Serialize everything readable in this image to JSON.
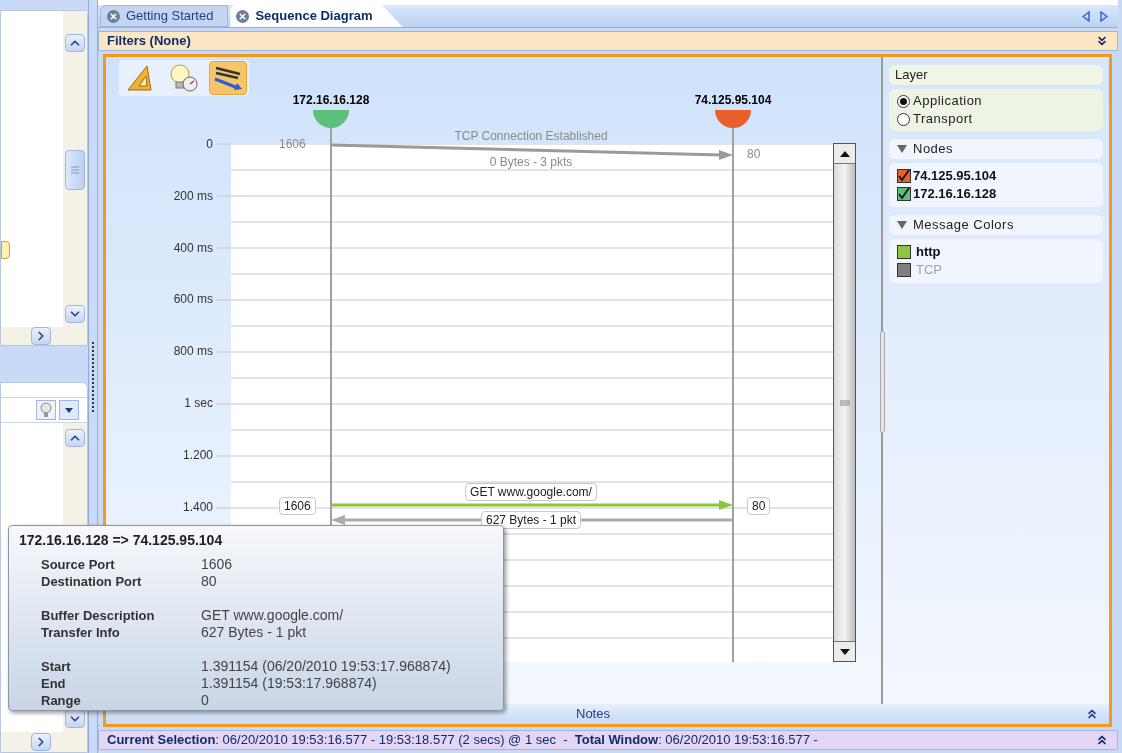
{
  "tabs": [
    {
      "label": "Getting Started",
      "selected": false
    },
    {
      "label": "Sequence Diagram",
      "selected": true
    }
  ],
  "filters": {
    "title": "Filters (None)"
  },
  "toolbar": [
    {
      "kind": "ruler",
      "selected": false
    },
    {
      "kind": "bulb",
      "selected": false
    },
    {
      "kind": "protocol",
      "selected": true
    }
  ],
  "diagram": {
    "nodes": [
      {
        "label": "172.16.16.128",
        "color": "#5cbf7c"
      },
      {
        "label": "74.125.95.104",
        "color": "#e8612c"
      }
    ],
    "axis_labels": [
      "0",
      "200 ms",
      "400 ms",
      "600 ms",
      "800 ms",
      "1 sec",
      "1.200",
      "1.400"
    ],
    "messages": [
      {
        "kind": "connection",
        "above": "TCP Connection Established",
        "below": "0 Bytes - 3 pkts",
        "source_port": "1606",
        "dest_port": "80",
        "color": "#9a9a9a"
      },
      {
        "kind": "request",
        "above": "GET www.google.com/",
        "source_port": "1606",
        "dest_port": "80",
        "color": "#8cc63f"
      },
      {
        "kind": "response",
        "below": "627 Bytes - 1 pkt",
        "color": "#ababab"
      }
    ]
  },
  "legend": {
    "layer": {
      "title": "Layer",
      "options": [
        {
          "label": "Application",
          "selected": true
        },
        {
          "label": "Transport",
          "selected": false
        }
      ]
    },
    "nodes": {
      "title": "Nodes",
      "expanded": true,
      "items": [
        {
          "label": "74.125.95.104",
          "checked": true,
          "color": "#e8612c"
        },
        {
          "label": "172.16.16.128",
          "checked": true,
          "color": "#5cbf7c"
        }
      ]
    },
    "message_colors": {
      "title": "Message Colors",
      "expanded": true,
      "items": [
        {
          "label": "http",
          "disabled": false,
          "color": "#8cc63f"
        },
        {
          "label": "TCP",
          "disabled": true,
          "color": "#808080"
        }
      ]
    }
  },
  "notes": {
    "title": "Notes"
  },
  "tooltip": {
    "title": "172.16.16.128 => 74.125.95.104",
    "groups": [
      [
        {
          "label": "Source Port",
          "value": "1606"
        },
        {
          "label": "Destination Port",
          "value": "80"
        }
      ],
      [
        {
          "label": "Buffer Description",
          "value": "GET www.google.com/"
        },
        {
          "label": "Transfer Info",
          "value": "627 Bytes - 1 pkt"
        }
      ],
      [
        {
          "label": "Start",
          "value": "1.391154 (06/20/2010 19:53:17.968874)"
        },
        {
          "label": "End",
          "value": "1.391154 (19:53:17.968874)"
        },
        {
          "label": "Range",
          "value": "0"
        }
      ]
    ]
  },
  "status_bar": {
    "text": "**Current Selection**: 06/20/2010 19:53:16.577 - 19:53:18.577 (2 secs) @ 1 sec  -  **Total Window**: 06/20/2010 19:53:16.577 -"
  }
}
